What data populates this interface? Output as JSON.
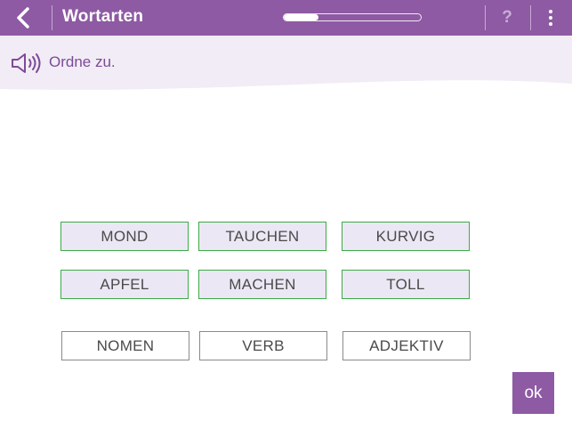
{
  "header": {
    "title": "Wortarten",
    "back_icon": "chevron-left-icon",
    "help_label": "?",
    "menu_icon": "vertical-dots-icon",
    "progress": 0.25
  },
  "instruction": {
    "text": "Ordne zu.",
    "icon": "speaker-icon"
  },
  "words": [
    {
      "label": "MOND"
    },
    {
      "label": "TAUCHEN"
    },
    {
      "label": "KURVIG"
    },
    {
      "label": "APFEL"
    },
    {
      "label": "MACHEN"
    },
    {
      "label": "TOLL"
    }
  ],
  "categories": [
    {
      "label": "NOMEN"
    },
    {
      "label": "VERB"
    },
    {
      "label": "ADJEKTIV"
    }
  ],
  "ok_button": {
    "label": "ok"
  },
  "colors": {
    "accent": "#8e5aa3",
    "word_border": "#3cab48",
    "word_fill": "#ece7f4",
    "band": "#f1ecf5"
  }
}
